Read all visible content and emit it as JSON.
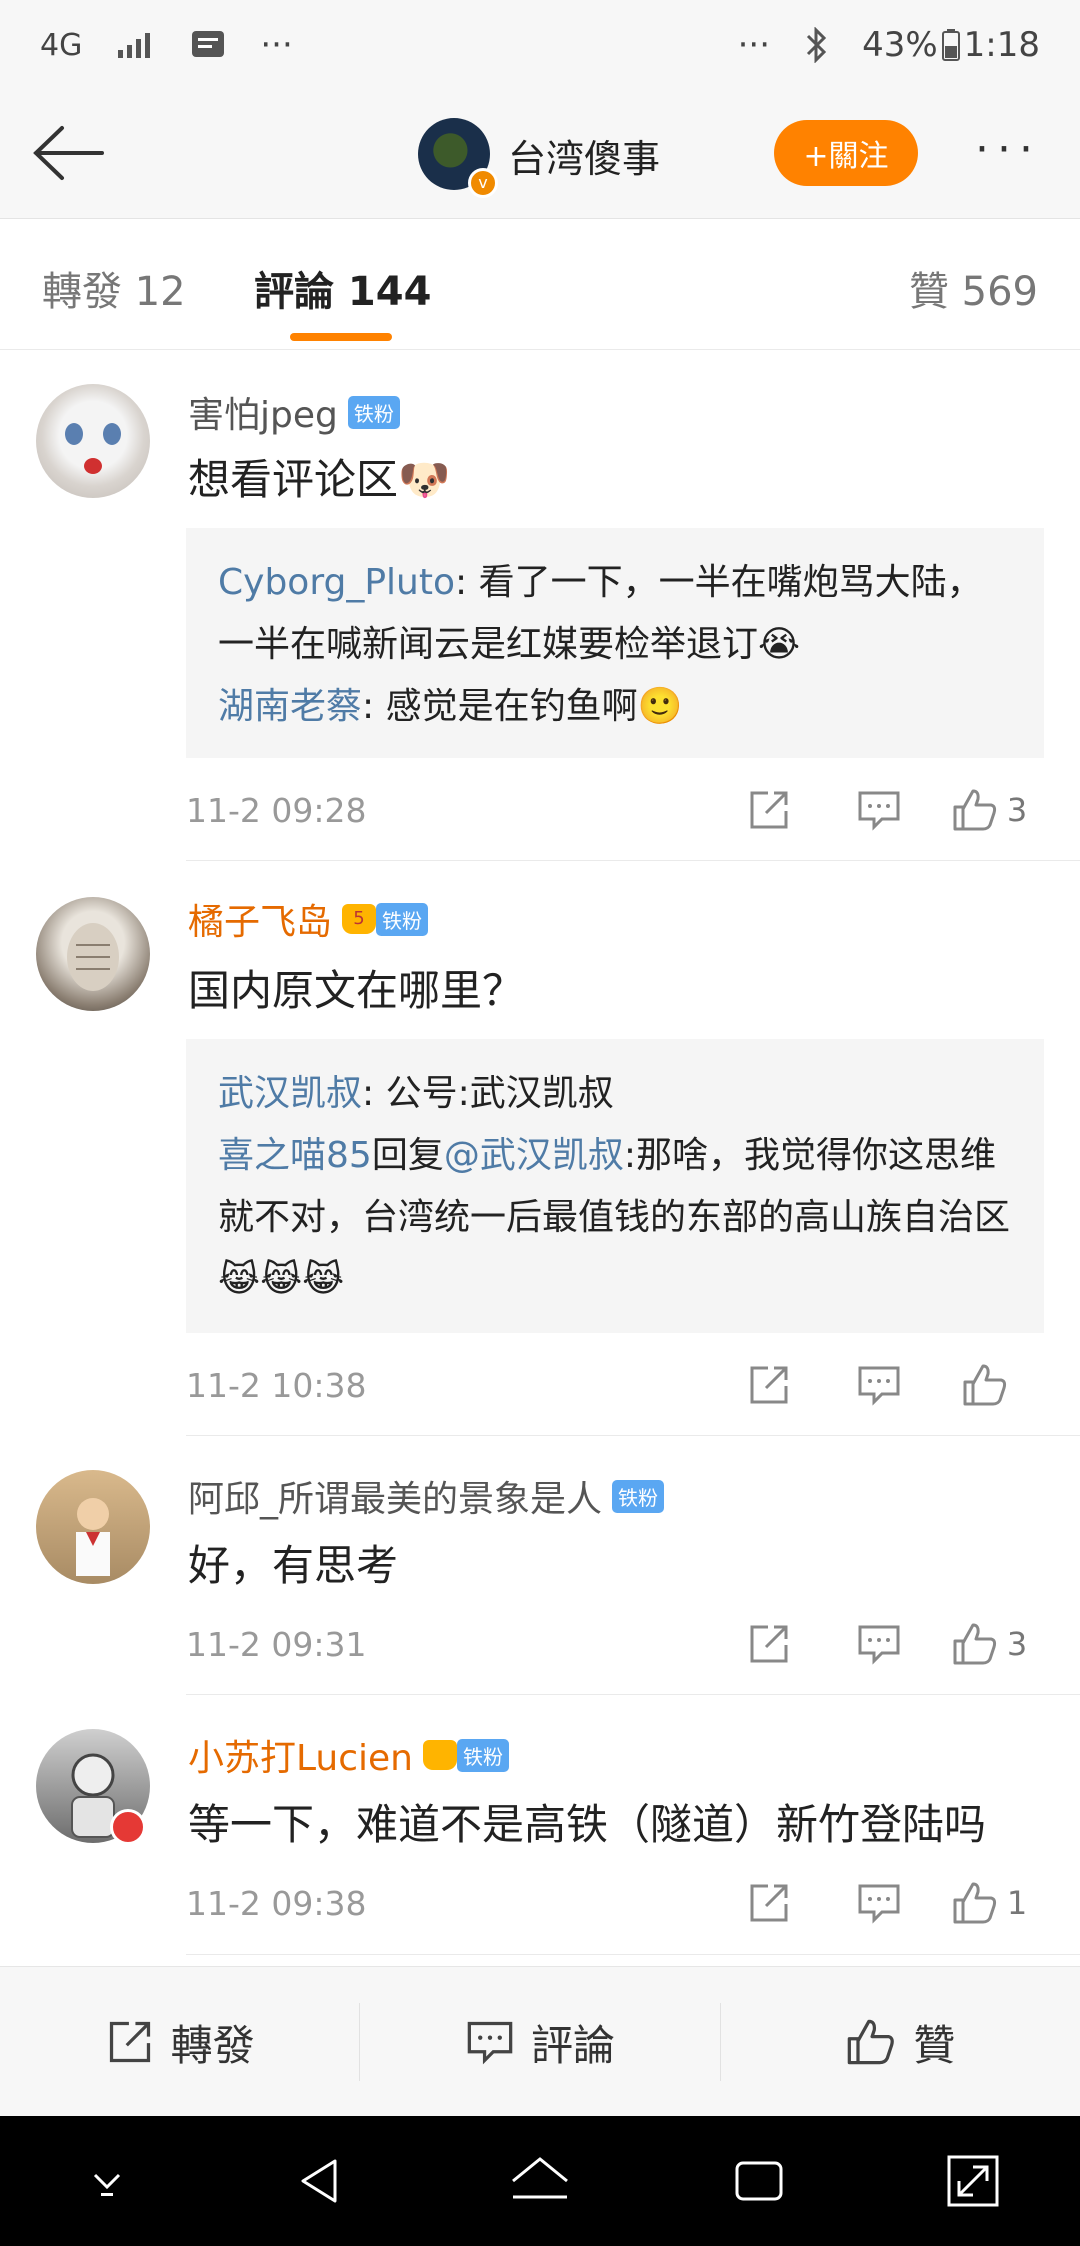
{
  "status_bar": {
    "network": "4G",
    "dots_left": "···",
    "dots_right": "···",
    "battery": "43%",
    "time": "1:18"
  },
  "header": {
    "title": "台湾傻事",
    "follow_label": "+關注",
    "more_label": "···"
  },
  "tabs": {
    "repost": "轉發 12",
    "comments": "評論 144",
    "likes": "贊 569"
  },
  "comments": [
    {
      "name": "害怕jpeg",
      "badge": "铁粉",
      "text": "想看评论区🐶",
      "replies": [
        {
          "user": "Cyborg_Pluto",
          "sep": ": ",
          "text": "看了一下，一半在嘴炮骂大陆，一半在喊新闻云是红媒要检举退订😭"
        },
        {
          "user": "湖南老蔡",
          "sep": ": ",
          "text": "感觉是在钓鱼啊🙂"
        }
      ],
      "time": "11-2 09:28",
      "likes": "3"
    },
    {
      "name": "橘子飞岛",
      "badge": "铁粉",
      "crown": "5",
      "text": "国内原文在哪里？",
      "replies": [
        {
          "user": "武汉凯叔",
          "sep": ": ",
          "text": "公号:武汉凯叔"
        },
        {
          "user": "喜之喵85",
          "reply_word": "回复",
          "mention": "@武汉凯叔",
          "text": ":那啥，我觉得你这思维就不对，台湾统一后最值钱的东部的高山族自治区😹😹😹"
        }
      ],
      "time": "11-2 10:38",
      "likes": ""
    },
    {
      "name": "阿邱_所谓最美的景象是人",
      "badge": "铁粉",
      "text": "好，有思考",
      "time": "11-2 09:31",
      "likes": "3"
    },
    {
      "name": "小苏打Lucien",
      "badge": "铁粉",
      "crown": "",
      "text": "等一下，难道不是高铁（隧道）新竹登陆吗",
      "time": "11-2 09:38",
      "likes": "1"
    }
  ],
  "bottom_bar": {
    "repost": "轉發",
    "comment": "評論",
    "like": "贊"
  }
}
